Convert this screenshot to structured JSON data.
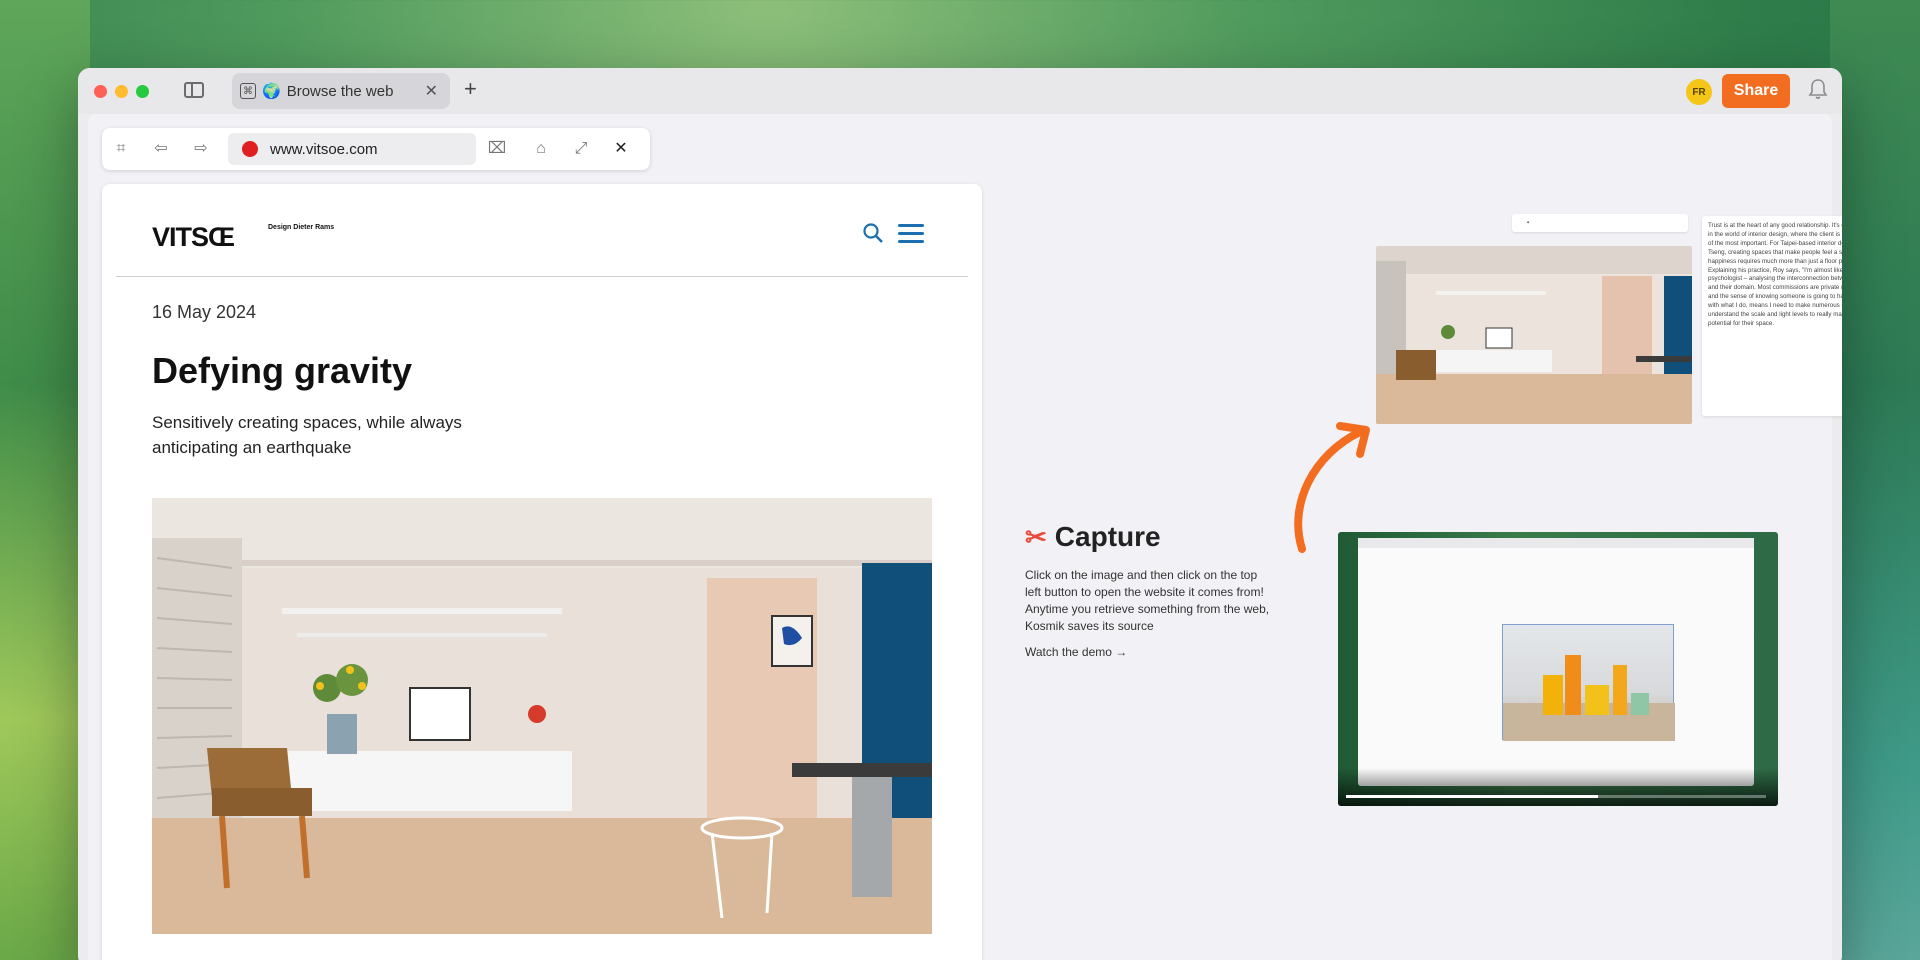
{
  "tab": {
    "title": "Browse the web",
    "globe": "🌍"
  },
  "toolbar": {
    "share_label": "Share",
    "avatar_initials": "FR",
    "new_tab": "+"
  },
  "browser": {
    "url": "www.vitsoe.com",
    "icons": [
      "capture-icon",
      "back-icon",
      "forward-icon",
      "bookmark-icon",
      "tag-icon",
      "expand-icon",
      "close-icon"
    ]
  },
  "article": {
    "logo": "VITSŒ",
    "logo_sub": "Design Dieter Rams",
    "date": "16 May 2024",
    "title": "Defying gravity",
    "subtitle": "Sensitively creating spaces, while always anticipating an earthquake"
  },
  "capture": {
    "title": "Capture",
    "description": "Click on the image and then click on the top left button to open the website it comes from! Anytime you retrieve something from the web, Kosmik saves its source",
    "link": "Watch the demo →"
  },
  "colors": {
    "accent": "#f36d20",
    "link_blue": "#1b6fae"
  }
}
